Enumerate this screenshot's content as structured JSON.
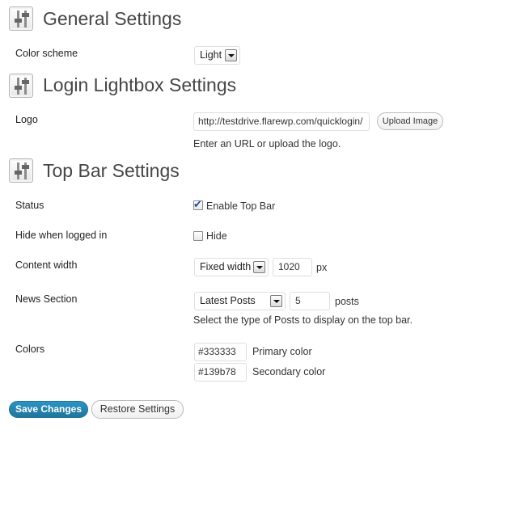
{
  "sections": {
    "general": {
      "title": "General Settings",
      "color_scheme_label": "Color scheme",
      "color_scheme_value": "Light"
    },
    "login": {
      "title": "Login Lightbox Settings",
      "logo_label": "Logo",
      "logo_value": "http://testdrive.flarewp.com/quicklogin/",
      "upload_label": "Upload Image",
      "logo_help": "Enter an URL or upload the logo."
    },
    "topbar": {
      "title": "Top Bar Settings",
      "status_label": "Status",
      "status_checkbox_label": "Enable Top Bar",
      "status_checked": true,
      "hide_label": "Hide when logged in",
      "hide_checkbox_label": "Hide",
      "hide_checked": false,
      "content_width_label": "Content width",
      "content_width_mode": "Fixed width",
      "content_width_value": "1020",
      "content_width_unit": "px",
      "news_label": "News Section",
      "news_type": "Latest Posts",
      "news_count": "5",
      "news_unit": "posts",
      "news_help": "Select the type of Posts to display on the top bar.",
      "colors_label": "Colors",
      "primary_color": "#333333",
      "primary_color_label": "Primary color",
      "secondary_color": "#139b78",
      "secondary_color_label": "Secondary color"
    }
  },
  "actions": {
    "save_label": "Save Changes",
    "restore_label": "Restore Settings"
  },
  "icons": {
    "section_icon": "settings-sliders-icon",
    "select_arrow": "chevron-down-icon",
    "checkmark": "checkmark-icon"
  },
  "theme": {
    "primary_button": "#21759b",
    "heading_color": "#464646"
  }
}
